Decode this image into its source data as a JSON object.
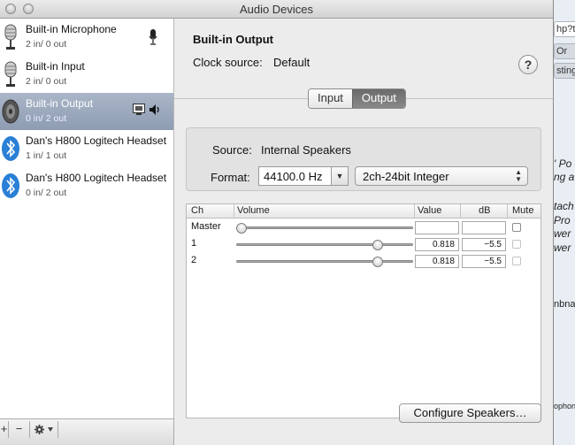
{
  "window": {
    "title": "Audio Devices"
  },
  "background_window": {
    "tab_top": "hp?t",
    "tab_1": "Or",
    "tab_2": "sting",
    "text_lines": [
      "' Po",
      "ng a",
      "tach",
      "Pro",
      "wer",
      "wer"
    ],
    "link_text": "nbna",
    "small_text": "ophone"
  },
  "sidebar": {
    "devices": [
      {
        "name": "Built-in Microphone",
        "io": "2 in/ 0 out",
        "icon": "microphone-icon"
      },
      {
        "name": "Built-in Input",
        "io": "2 in/ 0 out",
        "icon": "microphone-icon"
      },
      {
        "name": "Built-in Output",
        "io": "0 in/ 2 out",
        "icon": "speaker-icon"
      },
      {
        "name": "Dan's H800 Logitech Headset",
        "io": "1 in/ 1 out",
        "icon": "bluetooth-icon"
      },
      {
        "name": "Dan's H800 Logitech Headset",
        "io": "0 in/ 2 out",
        "icon": "bluetooth-icon"
      }
    ],
    "bottom": {
      "add": "+",
      "remove": "−"
    }
  },
  "detail": {
    "device_name": "Built-in Output",
    "clock_label": "Clock source:",
    "clock_value": "Default",
    "help": "?",
    "tabs": {
      "input": "Input",
      "output": "Output",
      "active": "output"
    },
    "source_label": "Source:",
    "source_value": "Internal Speakers",
    "format_label": "Format:",
    "sample_rate": "44100.0 Hz",
    "bit_format": "2ch-24bit Integer",
    "table": {
      "headers": {
        "ch": "Ch",
        "volume": "Volume",
        "value": "Value",
        "db": "dB",
        "mute": "Mute"
      },
      "rows": [
        {
          "ch": "Master",
          "value": "",
          "db": "",
          "level": 0.0,
          "muted": false
        },
        {
          "ch": "1",
          "value": "0.818",
          "db": "−5.5",
          "level": 0.818,
          "muted": false
        },
        {
          "ch": "2",
          "value": "0.818",
          "db": "−5.5",
          "level": 0.818,
          "muted": false
        }
      ]
    },
    "configure_button": "Configure Speakers…"
  },
  "colors": {
    "selection": "#8e9cb2",
    "bluetooth": "#2a7fd6"
  }
}
